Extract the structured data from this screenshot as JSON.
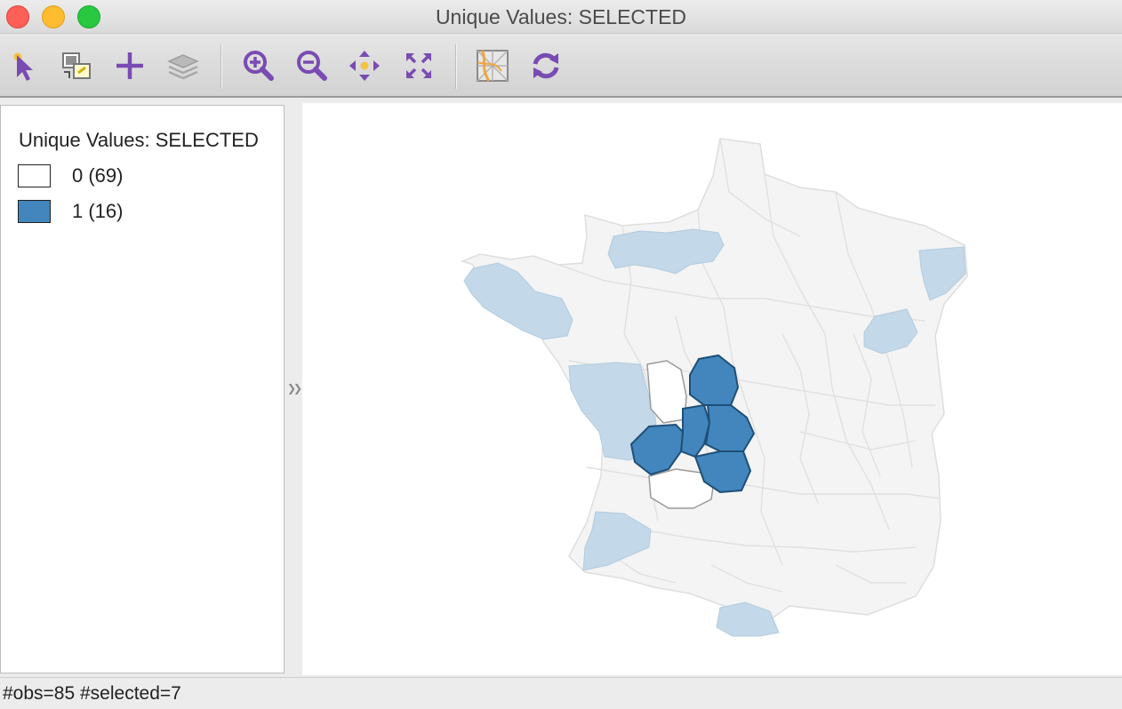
{
  "window": {
    "title": "Unique Values: SELECTED"
  },
  "toolbar": {
    "tools": [
      {
        "name": "select-tool",
        "icon": "pointer-arrow-icon"
      },
      {
        "name": "selection-shape-tool",
        "icon": "selection-shape-icon"
      },
      {
        "name": "add-tool",
        "icon": "plus-icon"
      },
      {
        "name": "layers-tool",
        "icon": "layers-icon"
      },
      {
        "name": "zoom-in-tool",
        "icon": "zoom-in-icon"
      },
      {
        "name": "zoom-out-tool",
        "icon": "zoom-out-icon"
      },
      {
        "name": "pan-tool",
        "icon": "pan-icon"
      },
      {
        "name": "full-extent-tool",
        "icon": "full-extent-icon"
      },
      {
        "name": "basemap-tool",
        "icon": "basemap-icon"
      },
      {
        "name": "refresh-tool",
        "icon": "refresh-icon"
      }
    ],
    "icon_color": "#7a4bb2"
  },
  "legend": {
    "title": "Unique Values: SELECTED",
    "items": [
      {
        "label": "0 (69)",
        "color": "#ffffff"
      },
      {
        "label": "1 (16)",
        "color": "#4286bd"
      }
    ]
  },
  "map": {
    "colors": {
      "base": "#f4f4f4",
      "base_border": "#dedede",
      "light_blue": "#c3d8e8",
      "selected": "#4286bd",
      "selected_border": "#1f4f77",
      "outlined": "#9a9a9a"
    }
  },
  "status": {
    "text": "#obs=85 #selected=7"
  }
}
